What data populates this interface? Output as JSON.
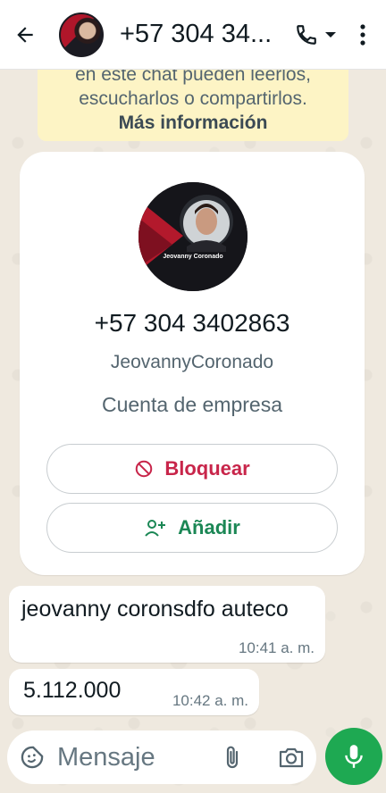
{
  "header": {
    "title": "+57 304 34...",
    "icons": [
      "back-arrow-icon",
      "phone-icon",
      "dropdown-caret-icon",
      "more-vert-icon"
    ]
  },
  "notice": {
    "line1": "en este chat pueden leerlos,",
    "line2": "escucharlos o compartirlos.",
    "more": "Más información"
  },
  "profile": {
    "avatar_name": "Jeovanny Coronado",
    "phone": "+57 304 3402863",
    "username": "JeovannyCoronado",
    "account_type": "Cuenta de empresa",
    "block_label": "Bloquear",
    "add_label": "Añadir"
  },
  "messages": [
    {
      "text": "jeovanny coronsdfo auteco",
      "time": "10:41 a. m."
    },
    {
      "text": "5.112.000",
      "time": "10:42 a. m."
    }
  ],
  "composer": {
    "placeholder": "Mensaje"
  },
  "colors": {
    "block": "#c8254a",
    "add": "#1b8755",
    "mic": "#1ea952",
    "notice_bg": "#fdf4c5"
  }
}
